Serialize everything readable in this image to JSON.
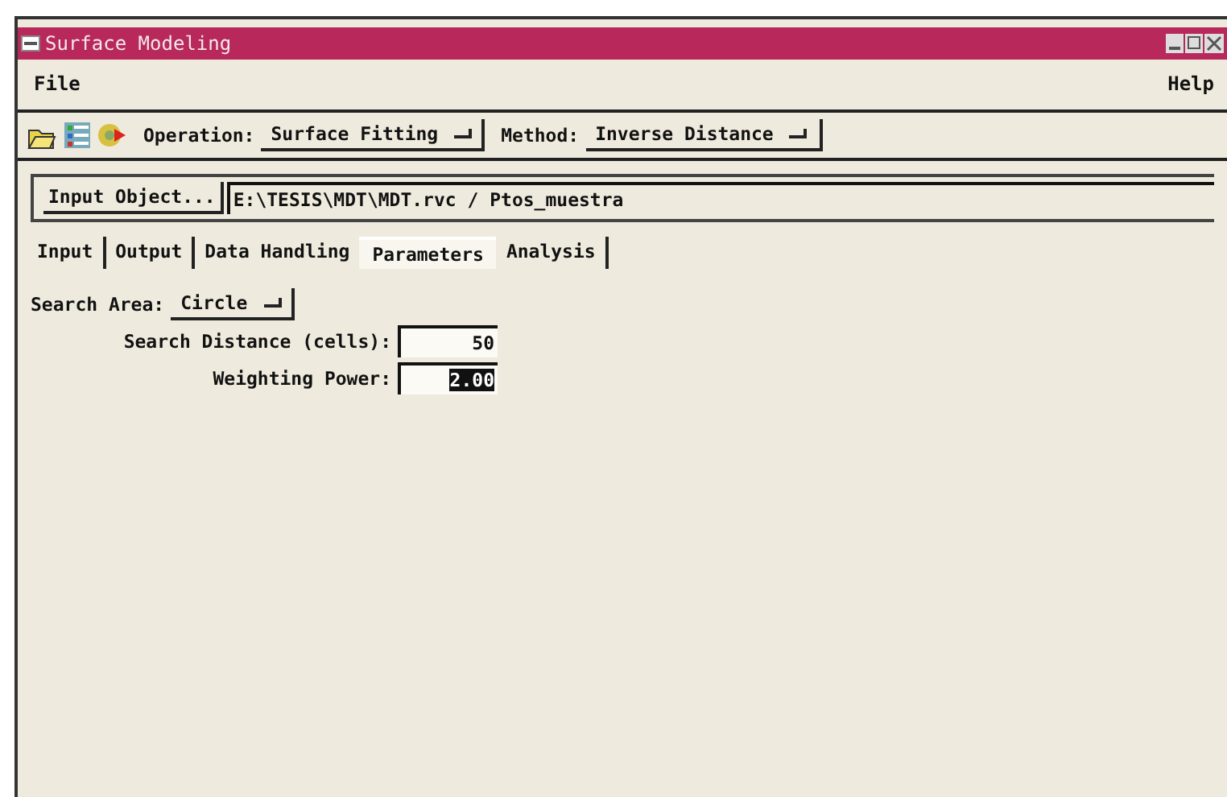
{
  "window": {
    "title": "Surface Modeling"
  },
  "menu": {
    "left": "File",
    "right": "Help"
  },
  "toolbar": {
    "operation": {
      "label": "Operation:",
      "value": "Surface Fitting"
    },
    "method": {
      "label": "Method:",
      "value": "Inverse Distance"
    }
  },
  "input": {
    "button": "Input Object...",
    "value": "E:\\TESIS\\MDT\\MDT.rvc / Ptos_muestra"
  },
  "tabs": [
    {
      "label": "Input",
      "selected": false
    },
    {
      "label": "Output",
      "selected": false
    },
    {
      "label": "Data Handling",
      "selected": false
    },
    {
      "label": "Parameters",
      "selected": true
    },
    {
      "label": "Analysis",
      "selected": false
    }
  ],
  "parameters": [
    {
      "kind": "dropdown",
      "label": "Search Area:",
      "value": "Circle"
    },
    {
      "kind": "number",
      "label": "Search Distance (cells):",
      "value": "50",
      "text_selected": false
    },
    {
      "kind": "number",
      "label": "Weighting Power:",
      "value": "2.00",
      "text_selected": true
    }
  ]
}
